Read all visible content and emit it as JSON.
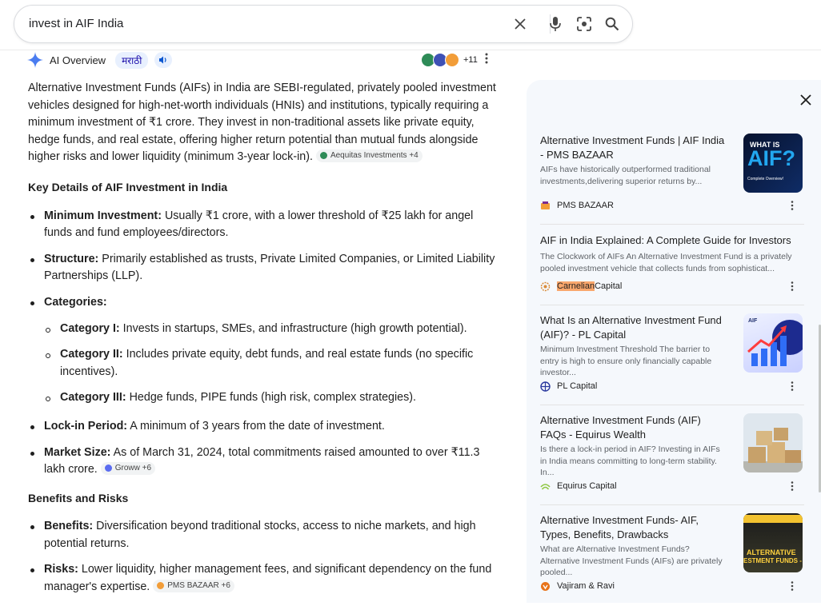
{
  "search": {
    "query": "invest in AIF India"
  },
  "ai_overview": {
    "label": "AI Overview",
    "language_chip": "मराठी",
    "source_count": "+11",
    "intro": "Alternative Investment Funds (AIFs) in India are SEBI-regulated, privately pooled investment vehicles designed for high-net-worth individuals (HNIs) and institutions, typically requiring a minimum investment of ₹1 crore. They invest in non-traditional assets like private equity, hedge funds, and real estate, offering higher return potential than mutual funds alongside higher risks and lower liquidity (minimum 3-year lock-in).",
    "intro_citation": "Aequitas Investments +4",
    "section1_heading": "Key Details of AIF Investment in India",
    "items": {
      "min_label": "Minimum Investment:",
      "min_text": " Usually ₹1 crore, with a lower threshold of ₹25 lakh for angel funds and fund employees/directors.",
      "structure_label": "Structure:",
      "structure_text": " Primarily established as trusts, Private Limited Companies, or Limited Liability Partnerships (LLP).",
      "categories_label": "Categories:",
      "cat1_label": "Category I:",
      "cat1_text": " Invests in startups, SMEs, and infrastructure (high growth potential).",
      "cat2_label": "Category II:",
      "cat2_text": " Includes private equity, debt funds, and real estate funds (no specific incentives).",
      "cat3_label": "Category III:",
      "cat3_text": " Hedge funds, PIPE funds (high risk, complex strategies).",
      "lockin_label": "Lock-in Period:",
      "lockin_text": " A minimum of 3 years from the date of investment.",
      "market_label": "Market Size:",
      "market_text": " As of March 31, 2024, total commitments raised amounted to over ₹11.3 lakh crore.",
      "market_citation": "Groww +6"
    },
    "section2_heading": "Benefits and Risks",
    "benefits_label": "Benefits:",
    "benefits_text": " Diversification beyond traditional stocks, access to niche markets, and high potential returns.",
    "risks_label": "Risks:",
    "risks_text": " Lower liquidity, higher management fees, and significant dependency on the fund manager's expertise.",
    "risks_citation": "PMS BAZAAR +6"
  },
  "panel": {
    "cards": [
      {
        "title": "Alternative Investment Funds | AIF India - PMS BAZAAR",
        "snippet": "AIFs have historically outperformed traditional investments,delivering superior returns by...",
        "source": "PMS BAZAAR",
        "thumb_text1": "WHAT IS",
        "thumb_text2": "AIF?",
        "thumb_text3": "Complete Overview!"
      },
      {
        "title": "AIF in India Explained: A Complete Guide for Investors",
        "snippet": "The Clockwork of AIFs An Alternative Investment Fund is a privately pooled investment vehicle that collects funds from sophisticat...",
        "source_highlight": "Carnelian",
        "source_rest": " Capital"
      },
      {
        "title": "What Is an Alternative Investment Fund (AIF)? - PL Capital",
        "snippet": "Minimum Investment Threshold The barrier to entry is high to ensure only financially capable investor...",
        "source": "PL Capital",
        "thumb_text": "AIF"
      },
      {
        "title": "Alternative Investment Funds (AIF) FAQs - Equirus Wealth",
        "snippet": "Is there a lock-in period in AIF? Investing in AIFs in India means committing to long-term stability. In...",
        "source": "Equirus Capital"
      },
      {
        "title": "Alternative Investment Funds- AIF, Types, Benefits, Drawbacks",
        "snippet": "What are Alternative Investment Funds? Alternative Investment Funds (AIFs) are privately pooled...",
        "source": "Vajiram & Ravi",
        "thumb_text1": "ALTERNATIVE",
        "thumb_text2": "ESTMENT FUNDS -"
      }
    ]
  }
}
